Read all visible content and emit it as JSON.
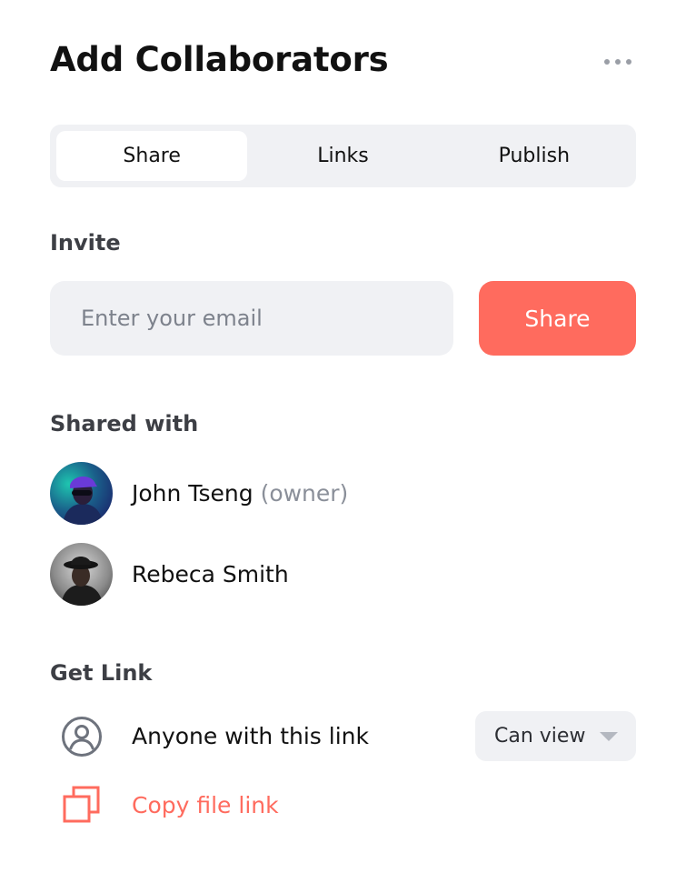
{
  "header": {
    "title": "Add Collaborators",
    "more_icon": "more-horizontal-icon"
  },
  "tabs": [
    {
      "label": "Share",
      "active": true
    },
    {
      "label": "Links",
      "active": false
    },
    {
      "label": "Publish",
      "active": false
    }
  ],
  "invite": {
    "label": "Invite",
    "email_placeholder": "Enter your email",
    "email_value": "",
    "share_button_label": "Share"
  },
  "shared_with": {
    "label": "Shared with",
    "people": [
      {
        "name": "John Tseng",
        "role": "(owner)",
        "avatar": "avatar-photo"
      },
      {
        "name": "Rebeca Smith",
        "role": "",
        "avatar": "avatar-photo"
      }
    ]
  },
  "get_link": {
    "label": "Get Link",
    "access_text": "Anyone with this link",
    "access_icon": "user-circle-icon",
    "permission": "Can view",
    "copy_label": "Copy file link",
    "copy_icon": "copy-icon"
  },
  "colors": {
    "accent": "#ff6b5e",
    "surface": "#f0f1f4",
    "muted_text": "#8a8f99"
  }
}
